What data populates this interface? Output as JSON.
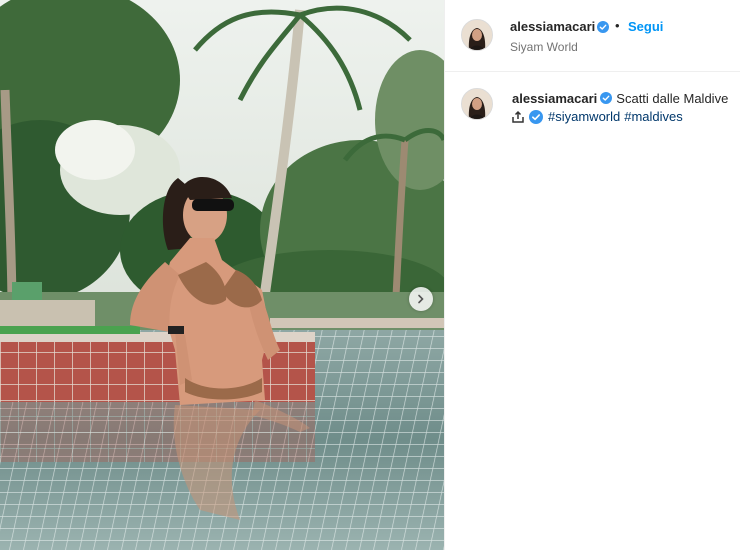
{
  "post": {
    "username": "alessiamacari",
    "location": "Siyam World",
    "follow_label": "Segui",
    "separator": "•",
    "caption": "Scatti dalle Maldive",
    "hashtags": [
      "#siyamworld",
      "#maldives"
    ]
  },
  "photo": {
    "description_icon": "pool-photo",
    "next_icon": "chevron-right-icon"
  },
  "colors": {
    "link_blue": "#0095f6",
    "hashtag_blue": "#00376b",
    "verified_blue": "#3897f0",
    "text": "#262626",
    "muted": "#737373"
  }
}
